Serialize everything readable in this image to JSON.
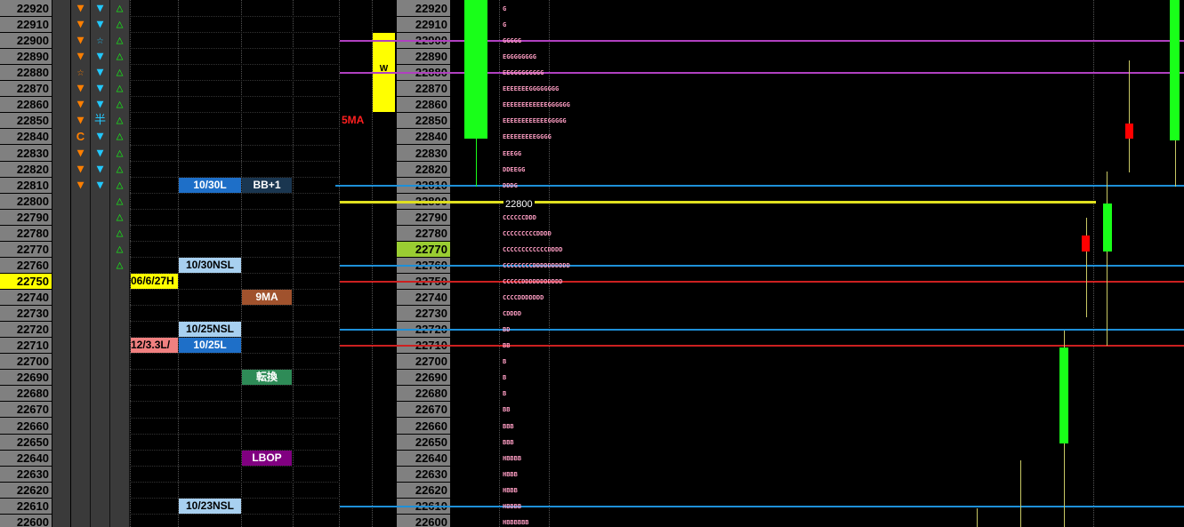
{
  "colors": {
    "background": "#000000",
    "price_column": "#808080",
    "highlight_price": "#ffff00",
    "green_price": "#9acd32",
    "tpo_letters": "#ff9ec4",
    "bull_candle": "#19ff19",
    "bear_candle": "#ff0000",
    "blue_line": "#1e90d8",
    "red_line": "#cc2020",
    "magenta_line": "#b040c0",
    "yellow_line": "#e0e020"
  },
  "price_ladder": [
    "22920",
    "22910",
    "22900",
    "22890",
    "22880",
    "22870",
    "22860",
    "22850",
    "22840",
    "22830",
    "22820",
    "22810",
    "22800",
    "22790",
    "22780",
    "22770",
    "22760",
    "22750",
    "22740",
    "22730",
    "22720",
    "22710",
    "22700",
    "22690",
    "22680",
    "22670",
    "22660",
    "22650",
    "22640",
    "22630",
    "22620",
    "22610",
    "22600"
  ],
  "highlighted_price": "22750",
  "center_highlight_price": "22770",
  "signal_marks": {
    "col1": [
      {
        "row": 0,
        "icon": "orange-down-triangle-icon",
        "glyph": "▼",
        "color": "#ff7f00"
      },
      {
        "row": 1,
        "icon": "orange-down-triangle-icon",
        "glyph": "▼",
        "color": "#ff7f00"
      },
      {
        "row": 2,
        "icon": "orange-down-triangle-icon",
        "glyph": "▼",
        "color": "#ff7f00"
      },
      {
        "row": 3,
        "icon": "orange-down-triangle-icon",
        "glyph": "▼",
        "color": "#ff7f00"
      },
      {
        "row": 4,
        "icon": "orange-star-icon",
        "glyph": "☆",
        "color": "#ff7f00"
      },
      {
        "row": 5,
        "icon": "orange-down-triangle-icon",
        "glyph": "▼",
        "color": "#ff7f00"
      },
      {
        "row": 6,
        "icon": "orange-down-triangle-icon",
        "glyph": "▼",
        "color": "#ff7f00"
      },
      {
        "row": 7,
        "icon": "orange-down-triangle-icon",
        "glyph": "▼",
        "color": "#ff7f00"
      },
      {
        "row": 8,
        "icon": "orange-c-icon",
        "glyph": "C",
        "color": "#ff7f00"
      },
      {
        "row": 9,
        "icon": "orange-down-triangle-icon",
        "glyph": "▼",
        "color": "#ff7f00"
      },
      {
        "row": 10,
        "icon": "orange-down-triangle-icon",
        "glyph": "▼",
        "color": "#ff7f00"
      },
      {
        "row": 11,
        "icon": "orange-down-triangle-icon",
        "glyph": "▼",
        "color": "#ff7f00"
      }
    ],
    "col2": [
      {
        "row": 0,
        "icon": "cyan-down-triangle-icon",
        "glyph": "▼",
        "color": "#22c8ff"
      },
      {
        "row": 1,
        "icon": "cyan-down-triangle-icon",
        "glyph": "▼",
        "color": "#22c8ff"
      },
      {
        "row": 2,
        "icon": "cyan-star-icon",
        "glyph": "☆",
        "color": "#22c8ff"
      },
      {
        "row": 3,
        "icon": "cyan-down-triangle-icon",
        "glyph": "▼",
        "color": "#22c8ff"
      },
      {
        "row": 4,
        "icon": "cyan-down-triangle-icon",
        "glyph": "▼",
        "color": "#22c8ff"
      },
      {
        "row": 5,
        "icon": "cyan-down-triangle-icon",
        "glyph": "▼",
        "color": "#22c8ff"
      },
      {
        "row": 6,
        "icon": "cyan-down-triangle-icon",
        "glyph": "▼",
        "color": "#22c8ff"
      },
      {
        "row": 7,
        "icon": "cyan-half-icon",
        "glyph": "半",
        "color": "#22c8ff"
      },
      {
        "row": 8,
        "icon": "cyan-down-triangle-icon",
        "glyph": "▼",
        "color": "#22c8ff"
      },
      {
        "row": 9,
        "icon": "cyan-down-triangle-icon",
        "glyph": "▼",
        "color": "#22c8ff"
      },
      {
        "row": 10,
        "icon": "cyan-down-triangle-icon",
        "glyph": "▼",
        "color": "#22c8ff"
      },
      {
        "row": 11,
        "icon": "cyan-down-triangle-icon",
        "glyph": "▼",
        "color": "#22c8ff"
      }
    ],
    "col3_rows": [
      0,
      1,
      2,
      3,
      4,
      5,
      6,
      7,
      8,
      9,
      10,
      11,
      12,
      13,
      14,
      15,
      16
    ],
    "col3_icon": "green-up-triangle-icon",
    "col3_glyph": "△",
    "col3_color": "#19e019"
  },
  "level_labels": [
    {
      "row": 11,
      "col": "c2",
      "text": "10/30L",
      "bg": "#1e6fc8",
      "fg": "#ffffff",
      "name": "label-10-30l"
    },
    {
      "row": 11,
      "col": "c3",
      "text": "BB+1",
      "bg": "#1a3650",
      "fg": "#ffffff",
      "name": "label-bb-plus-1"
    },
    {
      "row": 16,
      "col": "c2",
      "text": "10/30NSL",
      "bg": "#a8d0f0",
      "fg": "#000000",
      "name": "label-10-30nsl"
    },
    {
      "row": 17,
      "col": "c1",
      "text": "06/6/27H",
      "bg": "#ffff00",
      "fg": "#000000",
      "name": "label-06-6-27h"
    },
    {
      "row": 18,
      "col": "c3",
      "text": "9MA",
      "bg": "#a0522d",
      "fg": "#ffffff",
      "name": "label-9ma"
    },
    {
      "row": 20,
      "col": "c2",
      "text": "10/25NSL",
      "bg": "#a8d0f0",
      "fg": "#000000",
      "name": "label-10-25nsl"
    },
    {
      "row": 21,
      "col": "c1",
      "text": "/12/3.3L",
      "bg": "#f08080",
      "fg": "#000000",
      "name": "label-12-3-3l"
    },
    {
      "row": 21,
      "col": "c2",
      "text": "10/25L",
      "bg": "#1e6fc8",
      "fg": "#ffffff",
      "name": "label-10-25l"
    },
    {
      "row": 23,
      "col": "c3",
      "text": "転換",
      "bg": "#2e8b57",
      "fg": "#ffffff",
      "name": "label-tenkan"
    },
    {
      "row": 28,
      "col": "c3",
      "text": "LBOP",
      "bg": "#800080",
      "fg": "#ffffff",
      "name": "label-lbop"
    },
    {
      "row": 31,
      "col": "c2",
      "text": "10/23NSL",
      "bg": "#a8d0f0",
      "fg": "#000000",
      "name": "label-10-23nsl"
    }
  ],
  "ma_text": "5MA",
  "w_marker": "W",
  "price_tag_22800": "22800",
  "tpo_profile": [
    {
      "row": 0,
      "letters": "G"
    },
    {
      "row": 1,
      "letters": "G"
    },
    {
      "row": 2,
      "letters": "GGGGG"
    },
    {
      "row": 3,
      "letters": "EGGGGGGGG"
    },
    {
      "row": 4,
      "letters": "EEGGGGGGGGG"
    },
    {
      "row": 5,
      "letters": "EEEEEEEGGGGGGGG"
    },
    {
      "row": 6,
      "letters": "EEEEEEEEEEEEGGGGGG"
    },
    {
      "row": 7,
      "letters": "EEEEEEEEEEEEGGGGG"
    },
    {
      "row": 8,
      "letters": "EEEEEEEEEGGGG"
    },
    {
      "row": 9,
      "letters": "EEEGG"
    },
    {
      "row": 10,
      "letters": "DDEEGG"
    },
    {
      "row": 11,
      "letters": "DDDG"
    },
    {
      "row": 12,
      "letters": ""
    },
    {
      "row": 13,
      "letters": "CCCCCCDDD"
    },
    {
      "row": 14,
      "letters": "CCCCCCCCCDDDD"
    },
    {
      "row": 15,
      "letters": "CCCCCCCCCCCCDDDD"
    },
    {
      "row": 16,
      "letters": "CCCCCCCCDDDDDDDDDD"
    },
    {
      "row": 17,
      "letters": "CCCCCDDDDDDDDDDD"
    },
    {
      "row": 18,
      "letters": "CCCCDDDDDDD"
    },
    {
      "row": 19,
      "letters": "CDDDD"
    },
    {
      "row": 20,
      "letters": "BD"
    },
    {
      "row": 21,
      "letters": "BB"
    },
    {
      "row": 22,
      "letters": "B"
    },
    {
      "row": 23,
      "letters": "B"
    },
    {
      "row": 24,
      "letters": "B"
    },
    {
      "row": 25,
      "letters": "BB"
    },
    {
      "row": 26,
      "letters": "BBB"
    },
    {
      "row": 27,
      "letters": "BBB"
    },
    {
      "row": 28,
      "letters": "HBBBB"
    },
    {
      "row": 29,
      "letters": "HBBB"
    },
    {
      "row": 30,
      "letters": "HBBB"
    },
    {
      "row": 31,
      "letters": "HBBBB"
    },
    {
      "row": 32,
      "letters": "HBBBBBB"
    }
  ],
  "horizontal_lines": [
    {
      "price": 22900,
      "color": "#b040c0",
      "name": "magenta-line-22900",
      "x_from": "center"
    },
    {
      "price": 22880,
      "color": "#b040c0",
      "name": "magenta-line-22880",
      "x_from": "center"
    },
    {
      "price": 22810,
      "color": "#1e90d8",
      "name": "blue-line-22810",
      "x_from": "labels"
    },
    {
      "price": 22800,
      "color": "#e0e020",
      "name": "yellow-line-22800",
      "x_from": "center"
    },
    {
      "price": 22760,
      "color": "#1e90d8",
      "name": "blue-line-22760",
      "x_from": "center"
    },
    {
      "price": 22750,
      "color": "#cc2020",
      "name": "red-line-22750",
      "x_from": "center"
    },
    {
      "price": 22720,
      "color": "#1e90d8",
      "name": "blue-line-22720",
      "x_from": "center"
    },
    {
      "price": 22710,
      "color": "#cc2020",
      "name": "red-line-22710",
      "x_from": "center"
    },
    {
      "price": 22610,
      "color": "#1e90d8",
      "name": "blue-line-22610",
      "x_from": "center"
    }
  ]
}
